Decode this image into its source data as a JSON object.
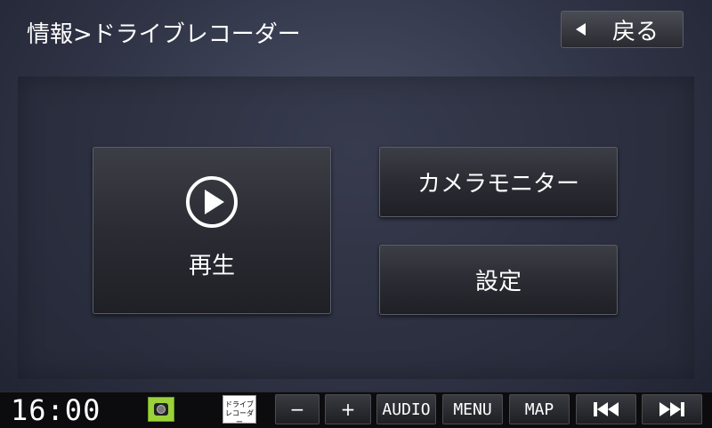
{
  "header": {
    "title": "情報>ドライブレコーダー",
    "back_label": "戻る"
  },
  "menu": {
    "play_label": "再生",
    "camera_monitor_label": "カメラモニター",
    "settings_label": "設定"
  },
  "statusbar": {
    "clock": "16:00",
    "drive_recorder_indicator_line1": "ドライブ",
    "drive_recorder_indicator_line2": "レコーダー",
    "camera_indicator_color": "#9bd23a",
    "buttons": {
      "minus": "−",
      "plus": "+",
      "audio": "AUDIO",
      "menu": "MENU",
      "map": "MAP"
    }
  }
}
